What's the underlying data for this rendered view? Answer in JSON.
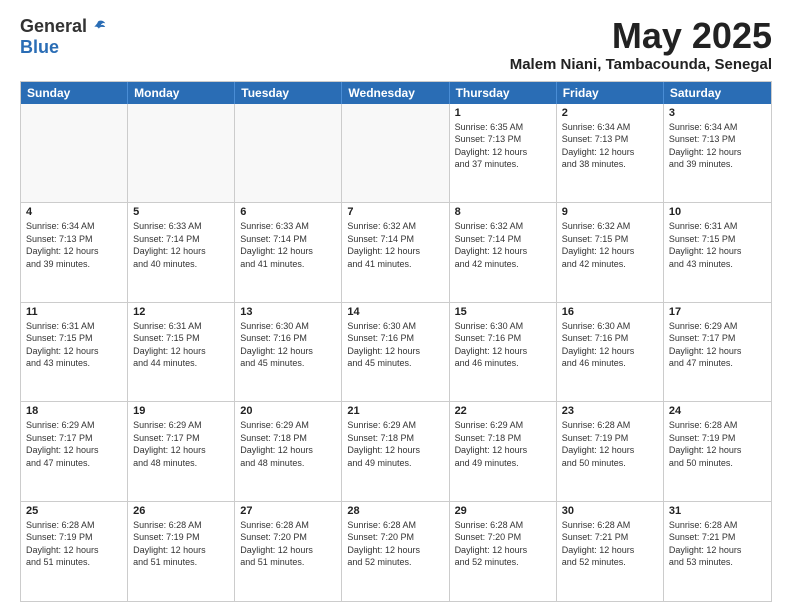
{
  "logo": {
    "general": "General",
    "blue": "Blue"
  },
  "header": {
    "month": "May 2025",
    "location": "Malem Niani, Tambacounda, Senegal"
  },
  "days": [
    "Sunday",
    "Monday",
    "Tuesday",
    "Wednesday",
    "Thursday",
    "Friday",
    "Saturday"
  ],
  "weeks": [
    [
      {
        "day": "",
        "info": "",
        "empty": true
      },
      {
        "day": "",
        "info": "",
        "empty": true
      },
      {
        "day": "",
        "info": "",
        "empty": true
      },
      {
        "day": "",
        "info": "",
        "empty": true
      },
      {
        "day": "1",
        "info": "Sunrise: 6:35 AM\nSunset: 7:13 PM\nDaylight: 12 hours\nand 37 minutes."
      },
      {
        "day": "2",
        "info": "Sunrise: 6:34 AM\nSunset: 7:13 PM\nDaylight: 12 hours\nand 38 minutes."
      },
      {
        "day": "3",
        "info": "Sunrise: 6:34 AM\nSunset: 7:13 PM\nDaylight: 12 hours\nand 39 minutes."
      }
    ],
    [
      {
        "day": "4",
        "info": "Sunrise: 6:34 AM\nSunset: 7:13 PM\nDaylight: 12 hours\nand 39 minutes."
      },
      {
        "day": "5",
        "info": "Sunrise: 6:33 AM\nSunset: 7:14 PM\nDaylight: 12 hours\nand 40 minutes."
      },
      {
        "day": "6",
        "info": "Sunrise: 6:33 AM\nSunset: 7:14 PM\nDaylight: 12 hours\nand 41 minutes."
      },
      {
        "day": "7",
        "info": "Sunrise: 6:32 AM\nSunset: 7:14 PM\nDaylight: 12 hours\nand 41 minutes."
      },
      {
        "day": "8",
        "info": "Sunrise: 6:32 AM\nSunset: 7:14 PM\nDaylight: 12 hours\nand 42 minutes."
      },
      {
        "day": "9",
        "info": "Sunrise: 6:32 AM\nSunset: 7:15 PM\nDaylight: 12 hours\nand 42 minutes."
      },
      {
        "day": "10",
        "info": "Sunrise: 6:31 AM\nSunset: 7:15 PM\nDaylight: 12 hours\nand 43 minutes."
      }
    ],
    [
      {
        "day": "11",
        "info": "Sunrise: 6:31 AM\nSunset: 7:15 PM\nDaylight: 12 hours\nand 43 minutes."
      },
      {
        "day": "12",
        "info": "Sunrise: 6:31 AM\nSunset: 7:15 PM\nDaylight: 12 hours\nand 44 minutes."
      },
      {
        "day": "13",
        "info": "Sunrise: 6:30 AM\nSunset: 7:16 PM\nDaylight: 12 hours\nand 45 minutes."
      },
      {
        "day": "14",
        "info": "Sunrise: 6:30 AM\nSunset: 7:16 PM\nDaylight: 12 hours\nand 45 minutes."
      },
      {
        "day": "15",
        "info": "Sunrise: 6:30 AM\nSunset: 7:16 PM\nDaylight: 12 hours\nand 46 minutes."
      },
      {
        "day": "16",
        "info": "Sunrise: 6:30 AM\nSunset: 7:16 PM\nDaylight: 12 hours\nand 46 minutes."
      },
      {
        "day": "17",
        "info": "Sunrise: 6:29 AM\nSunset: 7:17 PM\nDaylight: 12 hours\nand 47 minutes."
      }
    ],
    [
      {
        "day": "18",
        "info": "Sunrise: 6:29 AM\nSunset: 7:17 PM\nDaylight: 12 hours\nand 47 minutes."
      },
      {
        "day": "19",
        "info": "Sunrise: 6:29 AM\nSunset: 7:17 PM\nDaylight: 12 hours\nand 48 minutes."
      },
      {
        "day": "20",
        "info": "Sunrise: 6:29 AM\nSunset: 7:18 PM\nDaylight: 12 hours\nand 48 minutes."
      },
      {
        "day": "21",
        "info": "Sunrise: 6:29 AM\nSunset: 7:18 PM\nDaylight: 12 hours\nand 49 minutes."
      },
      {
        "day": "22",
        "info": "Sunrise: 6:29 AM\nSunset: 7:18 PM\nDaylight: 12 hours\nand 49 minutes."
      },
      {
        "day": "23",
        "info": "Sunrise: 6:28 AM\nSunset: 7:19 PM\nDaylight: 12 hours\nand 50 minutes."
      },
      {
        "day": "24",
        "info": "Sunrise: 6:28 AM\nSunset: 7:19 PM\nDaylight: 12 hours\nand 50 minutes."
      }
    ],
    [
      {
        "day": "25",
        "info": "Sunrise: 6:28 AM\nSunset: 7:19 PM\nDaylight: 12 hours\nand 51 minutes."
      },
      {
        "day": "26",
        "info": "Sunrise: 6:28 AM\nSunset: 7:19 PM\nDaylight: 12 hours\nand 51 minutes."
      },
      {
        "day": "27",
        "info": "Sunrise: 6:28 AM\nSunset: 7:20 PM\nDaylight: 12 hours\nand 51 minutes."
      },
      {
        "day": "28",
        "info": "Sunrise: 6:28 AM\nSunset: 7:20 PM\nDaylight: 12 hours\nand 52 minutes."
      },
      {
        "day": "29",
        "info": "Sunrise: 6:28 AM\nSunset: 7:20 PM\nDaylight: 12 hours\nand 52 minutes."
      },
      {
        "day": "30",
        "info": "Sunrise: 6:28 AM\nSunset: 7:21 PM\nDaylight: 12 hours\nand 52 minutes."
      },
      {
        "day": "31",
        "info": "Sunrise: 6:28 AM\nSunset: 7:21 PM\nDaylight: 12 hours\nand 53 minutes."
      }
    ]
  ]
}
